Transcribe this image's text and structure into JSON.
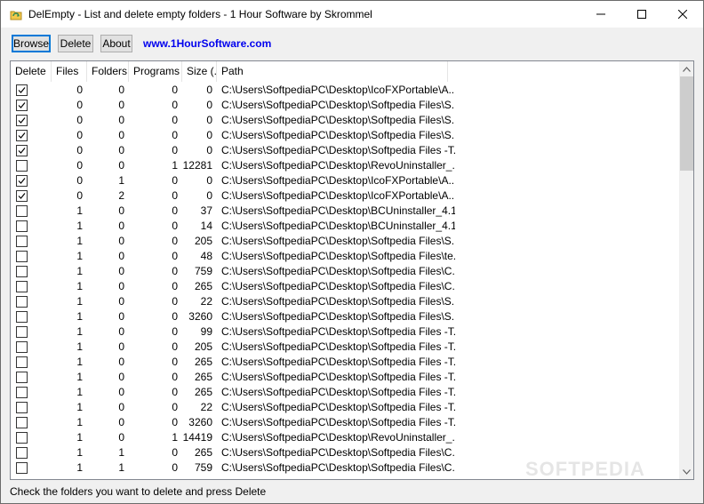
{
  "window": {
    "title": "DelEmpty - List and delete empty folders - 1 Hour Software by Skrommel"
  },
  "toolbar": {
    "browse_label": "Browse",
    "delete_label": "Delete",
    "about_label": "About",
    "link_text": "www.1HourSoftware.com",
    "link_color": "#0000ee"
  },
  "columns": [
    {
      "key": "delete",
      "label": "Delete"
    },
    {
      "key": "files",
      "label": "Files"
    },
    {
      "key": "folders",
      "label": "Folders"
    },
    {
      "key": "programs",
      "label": "Programs"
    },
    {
      "key": "size",
      "label": "Size (..."
    },
    {
      "key": "path",
      "label": "Path"
    }
  ],
  "rows": [
    {
      "checked": true,
      "files": "0",
      "folders": "0",
      "programs": "0",
      "size": "0",
      "path": "C:\\Users\\SoftpediaPC\\Desktop\\IcoFXPortable\\A..."
    },
    {
      "checked": true,
      "files": "0",
      "folders": "0",
      "programs": "0",
      "size": "0",
      "path": "C:\\Users\\SoftpediaPC\\Desktop\\Softpedia Files\\S..."
    },
    {
      "checked": true,
      "files": "0",
      "folders": "0",
      "programs": "0",
      "size": "0",
      "path": "C:\\Users\\SoftpediaPC\\Desktop\\Softpedia Files\\S..."
    },
    {
      "checked": true,
      "files": "0",
      "folders": "0",
      "programs": "0",
      "size": "0",
      "path": "C:\\Users\\SoftpediaPC\\Desktop\\Softpedia Files\\S..."
    },
    {
      "checked": true,
      "files": "0",
      "folders": "0",
      "programs": "0",
      "size": "0",
      "path": "C:\\Users\\SoftpediaPC\\Desktop\\Softpedia Files -T..."
    },
    {
      "checked": false,
      "files": "0",
      "folders": "0",
      "programs": "1",
      "size": "12281",
      "path": "C:\\Users\\SoftpediaPC\\Desktop\\RevoUninstaller_..."
    },
    {
      "checked": true,
      "files": "0",
      "folders": "1",
      "programs": "0",
      "size": "0",
      "path": "C:\\Users\\SoftpediaPC\\Desktop\\IcoFXPortable\\A..."
    },
    {
      "checked": true,
      "files": "0",
      "folders": "2",
      "programs": "0",
      "size": "0",
      "path": "C:\\Users\\SoftpediaPC\\Desktop\\IcoFXPortable\\A..."
    },
    {
      "checked": false,
      "files": "1",
      "folders": "0",
      "programs": "0",
      "size": "37",
      "path": "C:\\Users\\SoftpediaPC\\Desktop\\BCUninstaller_4.1..."
    },
    {
      "checked": false,
      "files": "1",
      "folders": "0",
      "programs": "0",
      "size": "14",
      "path": "C:\\Users\\SoftpediaPC\\Desktop\\BCUninstaller_4.1..."
    },
    {
      "checked": false,
      "files": "1",
      "folders": "0",
      "programs": "0",
      "size": "205",
      "path": "C:\\Users\\SoftpediaPC\\Desktop\\Softpedia Files\\S..."
    },
    {
      "checked": false,
      "files": "1",
      "folders": "0",
      "programs": "0",
      "size": "48",
      "path": "C:\\Users\\SoftpediaPC\\Desktop\\Softpedia Files\\te..."
    },
    {
      "checked": false,
      "files": "1",
      "folders": "0",
      "programs": "0",
      "size": "759",
      "path": "C:\\Users\\SoftpediaPC\\Desktop\\Softpedia Files\\C..."
    },
    {
      "checked": false,
      "files": "1",
      "folders": "0",
      "programs": "0",
      "size": "265",
      "path": "C:\\Users\\SoftpediaPC\\Desktop\\Softpedia Files\\C..."
    },
    {
      "checked": false,
      "files": "1",
      "folders": "0",
      "programs": "0",
      "size": "22",
      "path": "C:\\Users\\SoftpediaPC\\Desktop\\Softpedia Files\\S..."
    },
    {
      "checked": false,
      "files": "1",
      "folders": "0",
      "programs": "0",
      "size": "3260",
      "path": "C:\\Users\\SoftpediaPC\\Desktop\\Softpedia Files\\S..."
    },
    {
      "checked": false,
      "files": "1",
      "folders": "0",
      "programs": "0",
      "size": "99",
      "path": "C:\\Users\\SoftpediaPC\\Desktop\\Softpedia Files -T..."
    },
    {
      "checked": false,
      "files": "1",
      "folders": "0",
      "programs": "0",
      "size": "205",
      "path": "C:\\Users\\SoftpediaPC\\Desktop\\Softpedia Files -T..."
    },
    {
      "checked": false,
      "files": "1",
      "folders": "0",
      "programs": "0",
      "size": "265",
      "path": "C:\\Users\\SoftpediaPC\\Desktop\\Softpedia Files -T..."
    },
    {
      "checked": false,
      "files": "1",
      "folders": "0",
      "programs": "0",
      "size": "265",
      "path": "C:\\Users\\SoftpediaPC\\Desktop\\Softpedia Files -T..."
    },
    {
      "checked": false,
      "files": "1",
      "folders": "0",
      "programs": "0",
      "size": "265",
      "path": "C:\\Users\\SoftpediaPC\\Desktop\\Softpedia Files -T..."
    },
    {
      "checked": false,
      "files": "1",
      "folders": "0",
      "programs": "0",
      "size": "22",
      "path": "C:\\Users\\SoftpediaPC\\Desktop\\Softpedia Files -T..."
    },
    {
      "checked": false,
      "files": "1",
      "folders": "0",
      "programs": "0",
      "size": "3260",
      "path": "C:\\Users\\SoftpediaPC\\Desktop\\Softpedia Files -T..."
    },
    {
      "checked": false,
      "files": "1",
      "folders": "0",
      "programs": "1",
      "size": "14419",
      "path": "C:\\Users\\SoftpediaPC\\Desktop\\RevoUninstaller_..."
    },
    {
      "checked": false,
      "files": "1",
      "folders": "1",
      "programs": "0",
      "size": "265",
      "path": "C:\\Users\\SoftpediaPC\\Desktop\\Softpedia Files\\C..."
    },
    {
      "checked": false,
      "files": "1",
      "folders": "1",
      "programs": "0",
      "size": "759",
      "path": "C:\\Users\\SoftpediaPC\\Desktop\\Softpedia Files\\C..."
    }
  ],
  "status_text": "Check the folders you want to delete and press Delete",
  "watermark": "SOFTPEDIA",
  "icons": {
    "app": "recycle-folder-icon",
    "minimize": "minimize-icon",
    "maximize": "maximize-icon",
    "close": "close-icon",
    "scroll_up": "chevron-up-icon",
    "scroll_down": "chevron-down-icon",
    "checkbox": "checkmark-icon"
  }
}
